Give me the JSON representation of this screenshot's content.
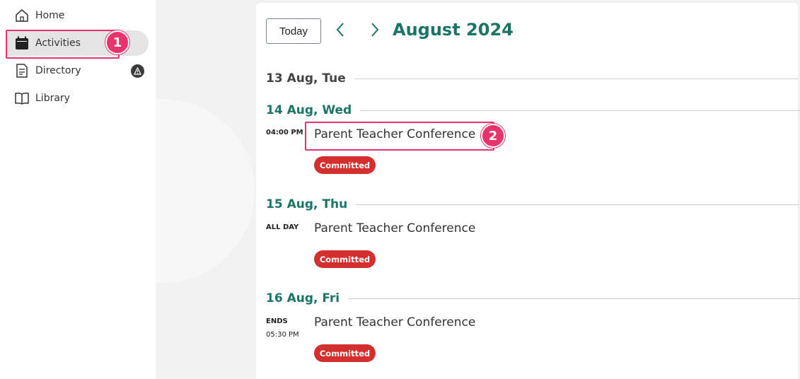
{
  "sidebar": {
    "items": [
      {
        "label": "Home",
        "icon": "home-icon"
      },
      {
        "label": "Activities",
        "icon": "calendar-icon"
      },
      {
        "label": "Directory",
        "icon": "document-icon"
      },
      {
        "label": "Library",
        "icon": "book-icon"
      }
    ],
    "active_index": 1
  },
  "calendar": {
    "today_label": "Today",
    "month_title": "August 2024",
    "days": [
      {
        "label": "13 Aug, Tue",
        "events": []
      },
      {
        "label": "14 Aug, Wed",
        "events": [
          {
            "time": "04:00 PM",
            "title": "Parent Teacher Conference",
            "status": "Committed"
          }
        ]
      },
      {
        "label": "15 Aug, Thu",
        "events": [
          {
            "time": "ALL DAY",
            "title": "Parent Teacher Conference",
            "status": "Committed"
          }
        ]
      },
      {
        "label": "16 Aug, Fri",
        "events": [
          {
            "time": "ENDS",
            "time_sub": "05:30 PM",
            "title": "Parent Teacher Conference",
            "status": "Committed"
          }
        ]
      }
    ]
  },
  "annotations": {
    "marker_1": "1",
    "marker_2": "2"
  },
  "colors": {
    "accent": "#1a7566",
    "status_committed": "#d32f2f",
    "annotation": "#e8336d"
  }
}
